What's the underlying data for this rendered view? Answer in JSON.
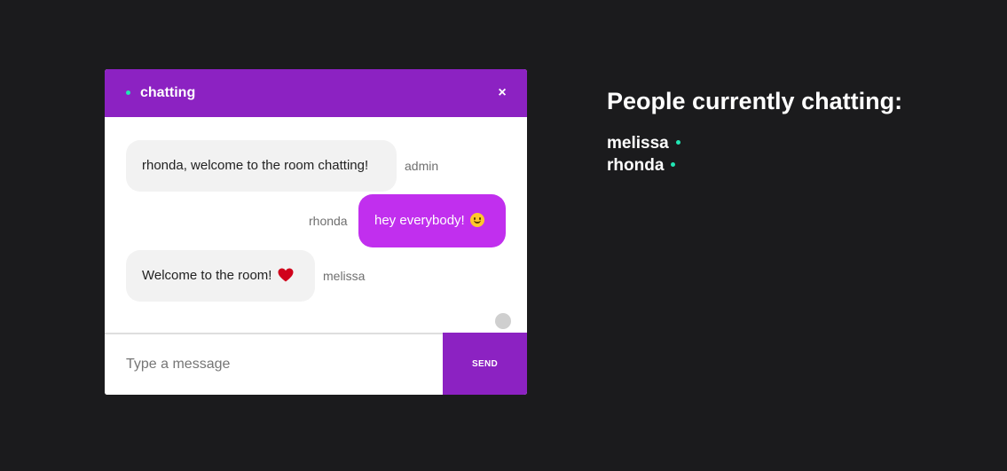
{
  "chat": {
    "room_name": "chatting",
    "close_label": "×",
    "messages": [
      {
        "text": "rhonda, welcome to the room chatting!",
        "sender": "admin",
        "direction": "incoming",
        "emoji": ""
      },
      {
        "text": "hey everybody!",
        "sender": "rhonda",
        "direction": "outgoing",
        "emoji": "smile-emoji"
      },
      {
        "text": "Welcome to the room!",
        "sender": "melissa",
        "direction": "incoming",
        "emoji": "heart-emoji"
      }
    ],
    "input_placeholder": "Type a message",
    "input_value": "",
    "send_label": "SEND"
  },
  "people": {
    "title": "People currently chatting:",
    "users": [
      "melissa",
      "rhonda"
    ]
  },
  "colors": {
    "page_background": "#1b1b1d",
    "header_purple": "#8c22c2",
    "outgoing_bubble": "#c12fee",
    "incoming_bubble": "#f2f2f2",
    "online_green": "#21e6b4",
    "heart_red": "#d0021b"
  }
}
